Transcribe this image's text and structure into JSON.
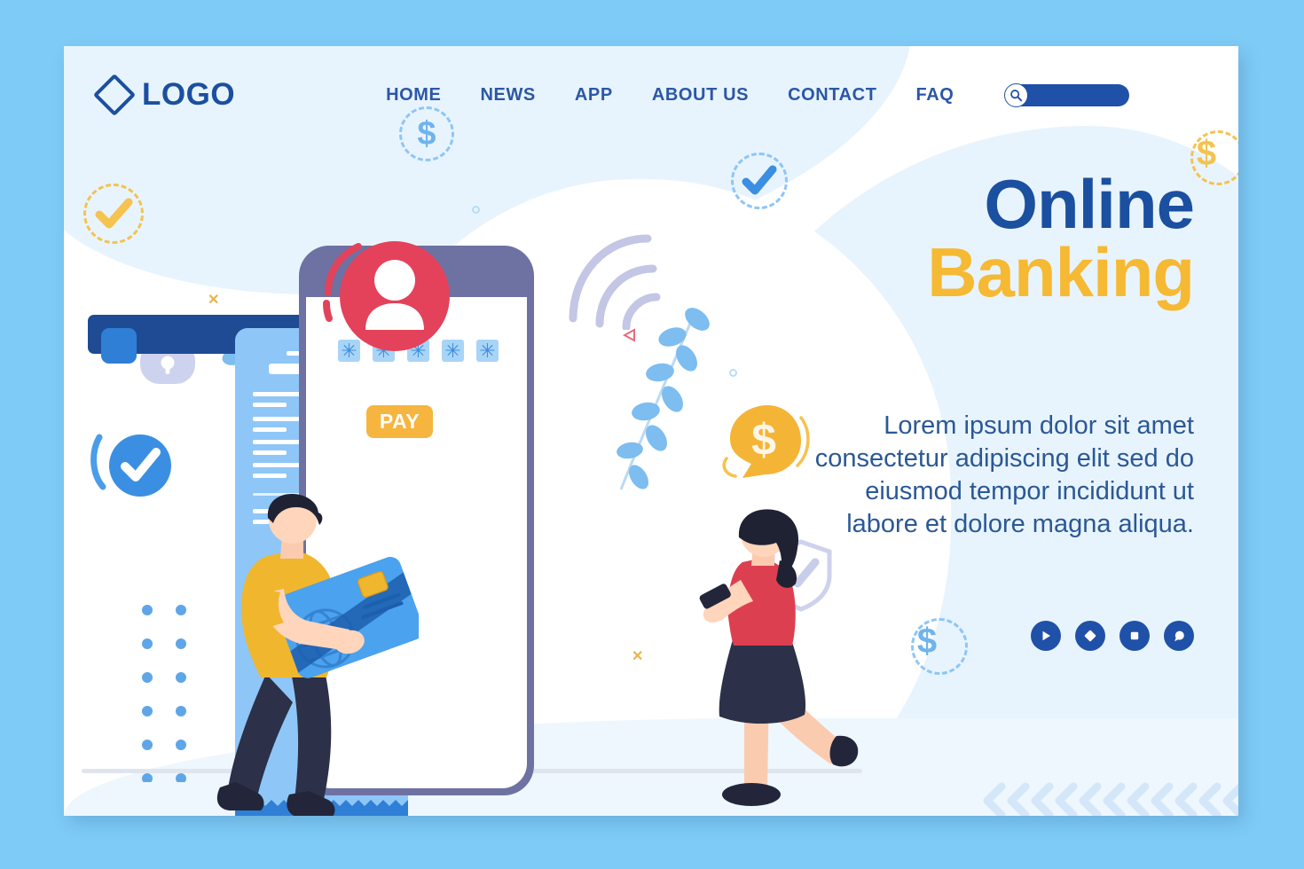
{
  "page": {
    "background_color": "#7ecbf7",
    "card_color": "#ffffff",
    "accent_blue": "#1b4fa0",
    "accent_yellow": "#f6b933",
    "accent_red": "#e8455c",
    "light_blue": "#8ec6f8"
  },
  "header": {
    "logo": {
      "text": "LOGO",
      "icon": "diamond-icon"
    },
    "nav": [
      {
        "label": "HOME"
      },
      {
        "label": "NEWS"
      },
      {
        "label": "APP"
      },
      {
        "label": "ABOUT US"
      },
      {
        "label": "CONTACT"
      },
      {
        "label": "FAQ"
      }
    ],
    "search": {
      "icon": "search-icon",
      "value": "",
      "placeholder": ""
    }
  },
  "hero": {
    "title_line1": "Online",
    "title_line2": "Banking",
    "paragraph": "Lorem ipsum dolor sit amet consectetur adipiscing elit sed do eiusmod tempor incididunt ut labore et dolore magna aliqua.",
    "socials": [
      {
        "icon": "play-icon"
      },
      {
        "icon": "diamond-icon"
      },
      {
        "icon": "square-icon"
      },
      {
        "icon": "chat-bubble-icon"
      }
    ]
  },
  "illustration": {
    "phone": {
      "password_dots": [
        "✳",
        "✳",
        "✳",
        "✳",
        "✳"
      ],
      "pay_button_label": "PAY"
    },
    "avatar_badge": {
      "icon": "user-avatar-icon",
      "color": "#e8455c"
    },
    "receipt": {
      "icon": "receipt-icon",
      "color": "#8ec6f8"
    },
    "man": {
      "icon": "man-holding-credit-card",
      "shirt": "#f0b62e",
      "pants": "#2c3048"
    },
    "woman": {
      "icon": "woman-with-phone",
      "top": "#dc4050",
      "skirt": "#2c3048"
    },
    "decorations": [
      {
        "icon": "dollar-dashed-circle-icon"
      },
      {
        "icon": "dollar-coin-icon"
      },
      {
        "icon": "dollar-dashed-circle-icon"
      },
      {
        "icon": "check-dashed-circle-icon"
      },
      {
        "icon": "check-badge-icon"
      },
      {
        "icon": "check-circle-icon"
      },
      {
        "icon": "padlock-icon"
      },
      {
        "icon": "shield-check-icon"
      },
      {
        "icon": "wifi-signal-icon"
      },
      {
        "icon": "leaf-branch-icon"
      },
      {
        "icon": "dot-grid-icon"
      },
      {
        "icon": "chevron-row-icon"
      }
    ]
  }
}
